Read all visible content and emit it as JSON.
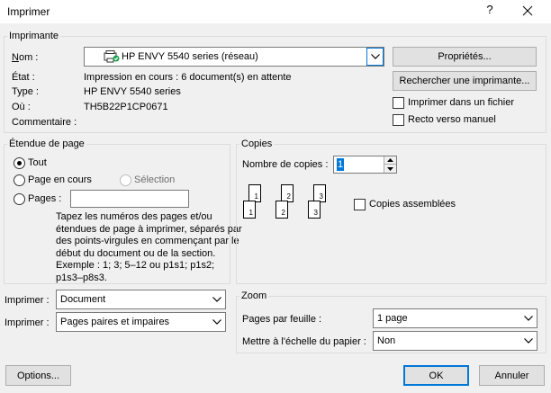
{
  "window": {
    "title": "Imprimer",
    "help": "?"
  },
  "printer": {
    "group_label": "Imprimante",
    "name_label": "Nom :",
    "name_value": "HP ENVY 5540 series (réseau)",
    "status_label": "État :",
    "status_value": "Impression en cours : 6 document(s) en attente",
    "type_label": "Type :",
    "type_value": "HP ENVY 5540 series",
    "where_label": "Où :",
    "where_value": "TH5B22P1CP0671",
    "comment_label": "Commentaire :",
    "properties_button": "Propriétés...",
    "find_button": "Rechercher une imprimante...",
    "print_to_file_label": "Imprimer dans un fichier",
    "print_to_file_checked": false,
    "manual_duplex_label": "Recto verso manuel",
    "manual_duplex_checked": false
  },
  "page_range": {
    "group_label": "Étendue de page",
    "all_label": "Tout",
    "current_label": "Page en cours",
    "selection_label": "Sélection",
    "pages_label": "Pages :",
    "pages_value": "",
    "selected": "all",
    "help_text": [
      "Tapez les numéros des pages et/ou",
      "étendues de page à imprimer, séparés par",
      "des points-virgules en commençant par le",
      "début du document ou de la section.",
      "Exemple : 1; 3; 5–12 ou p1s1; p1s2;",
      "p1s3–p8s3."
    ]
  },
  "copies": {
    "group_label": "Copies",
    "count_label": "Nombre de copies :",
    "count_value": "1",
    "collate_label": "Copies assemblées",
    "collate_checked": false,
    "collate_pages": [
      "1",
      "1",
      "2",
      "2",
      "3",
      "3"
    ]
  },
  "print_what": {
    "label": "Imprimer :",
    "value": "Document"
  },
  "print_pages": {
    "label": "Imprimer :",
    "value": "Pages paires et impaires"
  },
  "zoom": {
    "group_label": "Zoom",
    "pages_per_sheet_label": "Pages par feuille :",
    "pages_per_sheet_value": "1 page",
    "scale_label": "Mettre à l'échelle du papier :",
    "scale_value": "Non"
  },
  "footer": {
    "options_button": "Options...",
    "ok_button": "OK",
    "cancel_button": "Annuler"
  },
  "colors": {
    "accent": "#0078d7",
    "dialog_background": "#f0f0f0"
  }
}
